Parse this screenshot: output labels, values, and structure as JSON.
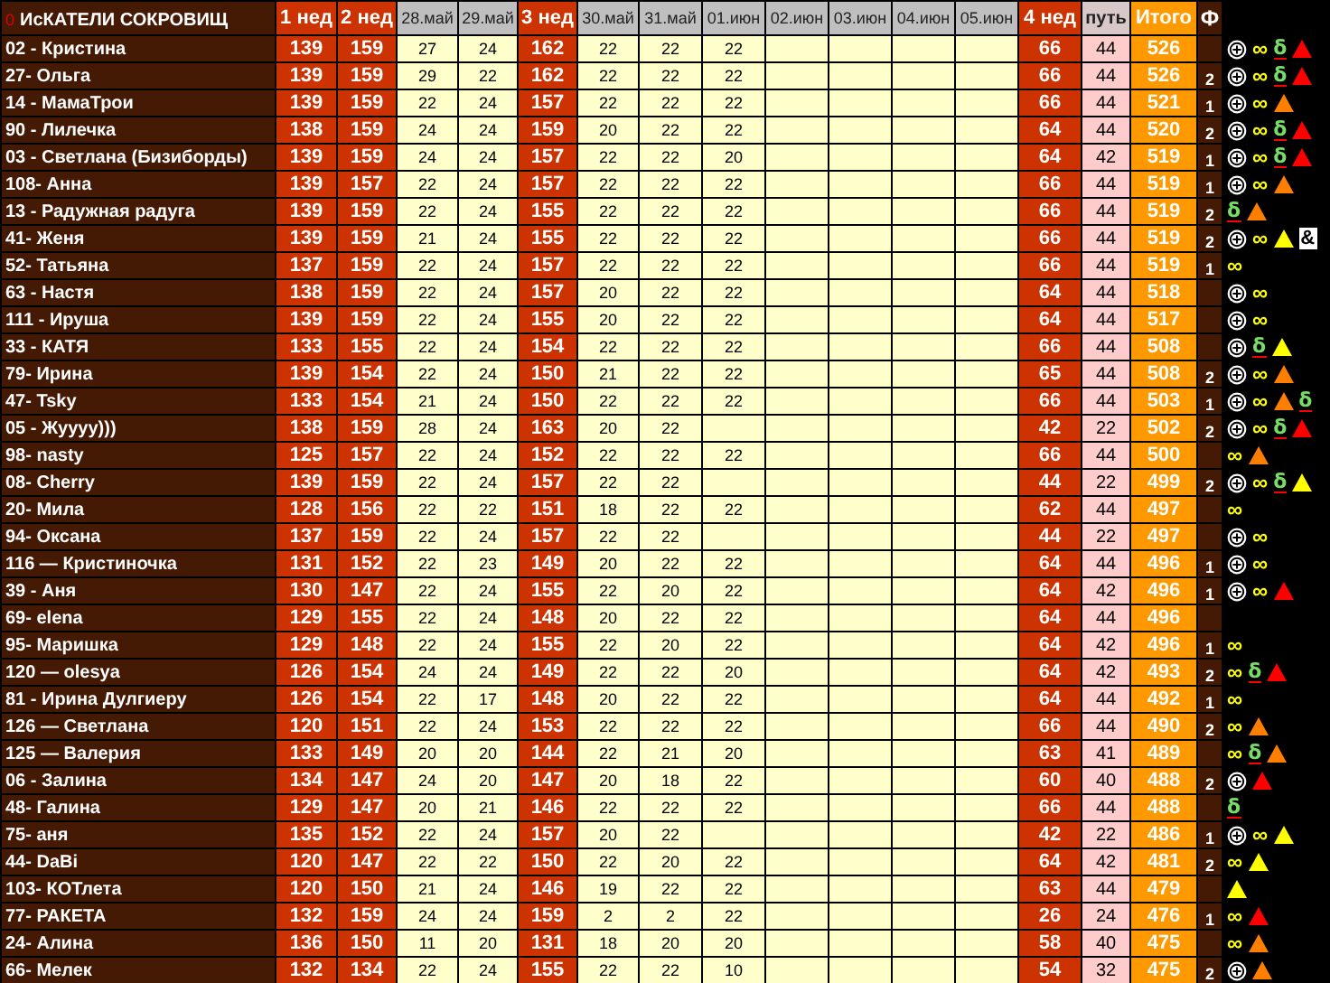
{
  "table": {
    "title_mark": "0",
    "title": "ИсКАТЕЛИ СОКРОВИЩ",
    "columns": [
      {
        "label": "1 нед",
        "kind": "week"
      },
      {
        "label": "2 нед",
        "kind": "week"
      },
      {
        "label": "28.май",
        "kind": "day"
      },
      {
        "label": "29.май",
        "kind": "day"
      },
      {
        "label": "3 нед",
        "kind": "week"
      },
      {
        "label": "30.май",
        "kind": "day"
      },
      {
        "label": "31.май",
        "kind": "day"
      },
      {
        "label": "01.июн",
        "kind": "day"
      },
      {
        "label": "02.июн",
        "kind": "day"
      },
      {
        "label": "03.июн",
        "kind": "day"
      },
      {
        "label": "04.июн",
        "kind": "day"
      },
      {
        "label": "05.июн",
        "kind": "day"
      },
      {
        "label": "4 нед",
        "kind": "week"
      },
      {
        "label": "путь",
        "kind": "path"
      },
      {
        "label": "Итого",
        "kind": "total"
      },
      {
        "label": "Ф",
        "kind": "phi"
      }
    ],
    "rows": [
      {
        "name": "02 - Кристина",
        "scores": [
          "139",
          "159",
          "27",
          "24",
          "162",
          "22",
          "22",
          "22"
        ],
        "totals": [
          "66",
          "44",
          "526"
        ],
        "marks": [
          {
            "kind": "circle"
          },
          {
            "kind": "symbol",
            "text": "∞"
          },
          {
            "kind": "delta",
            "text": "δ"
          },
          {
            "kind": "triangle",
            "color": "#ff0000"
          }
        ]
      },
      {
        "name": "27- Ольга",
        "scores": [
          "139",
          "159",
          "29",
          "22",
          "162",
          "22",
          "22",
          "22"
        ],
        "totals": [
          "66",
          "44",
          "526",
          "2"
        ],
        "marks": [
          {
            "kind": "circle"
          },
          {
            "kind": "symbol",
            "text": "∞"
          },
          {
            "kind": "delta",
            "text": "δ"
          },
          {
            "kind": "triangle",
            "color": "#ff0000"
          }
        ]
      },
      {
        "name": "14 - МамаТрои",
        "scores": [
          "139",
          "159",
          "22",
          "24",
          "157",
          "22",
          "22",
          "22"
        ],
        "totals": [
          "66",
          "44",
          "521",
          "1"
        ],
        "marks": [
          {
            "kind": "circle"
          },
          {
            "kind": "symbol",
            "text": "∞"
          },
          {
            "kind": "triangle",
            "color": "#ff8000"
          }
        ]
      },
      {
        "name": "90 - Лилечка",
        "scores": [
          "138",
          "159",
          "24",
          "24",
          "159",
          "20",
          "22",
          "22"
        ],
        "totals": [
          "64",
          "44",
          "520",
          "2"
        ],
        "marks": [
          {
            "kind": "circle"
          },
          {
            "kind": "symbol",
            "text": "∞"
          },
          {
            "kind": "delta",
            "text": "δ"
          },
          {
            "kind": "triangle",
            "color": "#ff0000"
          }
        ]
      },
      {
        "name": "03 - Светлана (Бизиборды)",
        "scores": [
          "139",
          "159",
          "24",
          "24",
          "157",
          "22",
          "22",
          "20"
        ],
        "totals": [
          "64",
          "42",
          "519",
          "1"
        ],
        "marks": [
          {
            "kind": "circle"
          },
          {
            "kind": "symbol",
            "text": "∞"
          },
          {
            "kind": "delta",
            "text": "δ"
          },
          {
            "kind": "triangle",
            "color": "#ff0000"
          }
        ]
      },
      {
        "name": "108- Анна",
        "scores": [
          "139",
          "157",
          "22",
          "24",
          "157",
          "22",
          "22",
          "22"
        ],
        "totals": [
          "66",
          "44",
          "519",
          "1"
        ],
        "marks": [
          {
            "kind": "circle"
          },
          {
            "kind": "symbol",
            "text": "∞"
          },
          {
            "kind": "triangle",
            "color": "#ff8000"
          }
        ]
      },
      {
        "name": "13 - Радужная радуга",
        "scores": [
          "139",
          "159",
          "22",
          "24",
          "155",
          "22",
          "22",
          "22"
        ],
        "totals": [
          "66",
          "44",
          "519",
          "2"
        ],
        "marks": [
          {
            "kind": "delta",
            "text": "δ"
          },
          {
            "kind": "triangle",
            "color": "#ff8000"
          }
        ]
      },
      {
        "name": "41- Женя",
        "scores": [
          "139",
          "159",
          "21",
          "24",
          "155",
          "22",
          "22",
          "22"
        ],
        "totals": [
          "66",
          "44",
          "519",
          "2"
        ],
        "marks": [
          {
            "kind": "circle"
          },
          {
            "kind": "symbol",
            "text": "∞"
          },
          {
            "kind": "triangle",
            "color": "#ffff00"
          },
          {
            "kind": "box",
            "text": "&"
          }
        ]
      },
      {
        "name": "52- Татьяна",
        "scores": [
          "137",
          "159",
          "22",
          "24",
          "157",
          "22",
          "22",
          "22"
        ],
        "totals": [
          "66",
          "44",
          "519",
          "1"
        ],
        "marks": [
          {
            "kind": "symbol",
            "text": "∞"
          }
        ]
      },
      {
        "name": "63 - Настя",
        "scores": [
          "138",
          "159",
          "22",
          "24",
          "157",
          "20",
          "22",
          "22"
        ],
        "totals": [
          "64",
          "44",
          "518"
        ],
        "marks": [
          {
            "kind": "circle"
          },
          {
            "kind": "symbol",
            "text": "∞"
          }
        ]
      },
      {
        "name": "111 - Ируша",
        "scores": [
          "139",
          "159",
          "22",
          "24",
          "155",
          "20",
          "22",
          "22"
        ],
        "totals": [
          "64",
          "44",
          "517"
        ],
        "marks": [
          {
            "kind": "circle"
          },
          {
            "kind": "symbol",
            "text": "∞"
          }
        ]
      },
      {
        "name": "33 - КАТЯ",
        "scores": [
          "133",
          "155",
          "22",
          "24",
          "154",
          "22",
          "22",
          "22"
        ],
        "totals": [
          "66",
          "44",
          "508"
        ],
        "marks": [
          {
            "kind": "circle"
          },
          {
            "kind": "delta",
            "text": "δ"
          },
          {
            "kind": "triangle",
            "color": "#ffff00"
          }
        ]
      },
      {
        "name": "79- Ирина",
        "scores": [
          "139",
          "154",
          "22",
          "24",
          "150",
          "21",
          "22",
          "22"
        ],
        "totals": [
          "65",
          "44",
          "508",
          "2"
        ],
        "marks": [
          {
            "kind": "circle"
          },
          {
            "kind": "symbol",
            "text": "∞"
          },
          {
            "kind": "triangle",
            "color": "#ff8000"
          }
        ]
      },
      {
        "name": "47- Tsky",
        "scores": [
          "133",
          "154",
          "21",
          "24",
          "150",
          "22",
          "22",
          "22"
        ],
        "totals": [
          "66",
          "44",
          "503",
          "1"
        ],
        "marks": [
          {
            "kind": "circle"
          },
          {
            "kind": "symbol",
            "text": "∞"
          },
          {
            "kind": "triangle",
            "color": "#ff8000"
          },
          {
            "kind": "delta",
            "text": "δ"
          }
        ]
      },
      {
        "name": "05 - Жуууу)))",
        "scores": [
          "138",
          "159",
          "28",
          "24",
          "163",
          "20",
          "22"
        ],
        "totals": [
          "42",
          "22",
          "502",
          "2"
        ],
        "marks": [
          {
            "kind": "circle"
          },
          {
            "kind": "symbol",
            "text": "∞"
          },
          {
            "kind": "delta",
            "text": "δ"
          },
          {
            "kind": "triangle",
            "color": "#ff0000"
          }
        ]
      },
      {
        "name": "98- nasty",
        "scores": [
          "125",
          "157",
          "22",
          "24",
          "152",
          "22",
          "22",
          "22"
        ],
        "totals": [
          "66",
          "44",
          "500"
        ],
        "marks": [
          {
            "kind": "symbol",
            "text": "∞"
          },
          {
            "kind": "triangle",
            "color": "#ff8000"
          }
        ]
      },
      {
        "name": "08- Cherry",
        "scores": [
          "139",
          "159",
          "22",
          "24",
          "157",
          "22",
          "22"
        ],
        "totals": [
          "44",
          "22",
          "499",
          "2"
        ],
        "marks": [
          {
            "kind": "circle"
          },
          {
            "kind": "symbol",
            "text": "∞"
          },
          {
            "kind": "delta",
            "text": "δ"
          },
          {
            "kind": "triangle",
            "color": "#ffff00"
          }
        ]
      },
      {
        "name": "20- Мила",
        "scores": [
          "128",
          "156",
          "22",
          "22",
          "151",
          "18",
          "22",
          "22"
        ],
        "totals": [
          "62",
          "44",
          "497"
        ],
        "marks": [
          {
            "kind": "symbol",
            "text": "∞"
          }
        ]
      },
      {
        "name": "94- Оксана",
        "scores": [
          "137",
          "159",
          "22",
          "24",
          "157",
          "22",
          "22"
        ],
        "totals": [
          "44",
          "22",
          "497"
        ],
        "marks": [
          {
            "kind": "circle"
          },
          {
            "kind": "symbol",
            "text": "∞"
          }
        ]
      },
      {
        "name": "116 — Кристиночка",
        "scores": [
          "131",
          "152",
          "22",
          "23",
          "149",
          "20",
          "22",
          "22"
        ],
        "totals": [
          "64",
          "44",
          "496",
          "1"
        ],
        "marks": [
          {
            "kind": "circle"
          },
          {
            "kind": "symbol",
            "text": "∞"
          }
        ]
      },
      {
        "name": "39 - Аня",
        "scores": [
          "130",
          "147",
          "22",
          "24",
          "155",
          "22",
          "20",
          "22"
        ],
        "totals": [
          "64",
          "42",
          "496",
          "1"
        ],
        "marks": [
          {
            "kind": "circle"
          },
          {
            "kind": "symbol",
            "text": "∞"
          },
          {
            "kind": "triangle",
            "color": "#ff0000"
          }
        ]
      },
      {
        "name": "69- elena",
        "scores": [
          "129",
          "155",
          "22",
          "24",
          "148",
          "20",
          "22",
          "22"
        ],
        "totals": [
          "64",
          "44",
          "496"
        ]
      },
      {
        "name": "95- Маришка",
        "scores": [
          "129",
          "148",
          "22",
          "24",
          "155",
          "22",
          "20",
          "22"
        ],
        "totals": [
          "64",
          "42",
          "496",
          "1"
        ],
        "marks": [
          {
            "kind": "symbol",
            "text": "∞"
          }
        ]
      },
      {
        "name": "120 — olesya",
        "scores": [
          "126",
          "154",
          "24",
          "24",
          "149",
          "22",
          "22",
          "20"
        ],
        "totals": [
          "64",
          "42",
          "493",
          "2"
        ],
        "marks": [
          {
            "kind": "symbol",
            "text": "∞"
          },
          {
            "kind": "delta",
            "text": "δ"
          },
          {
            "kind": "triangle",
            "color": "#ff0000"
          }
        ]
      },
      {
        "name": "81 - Ирина Дулгиеру",
        "scores": [
          "126",
          "154",
          "22",
          "17",
          "148",
          "20",
          "22",
          "22"
        ],
        "totals": [
          "64",
          "44",
          "492",
          "1"
        ],
        "marks": [
          {
            "kind": "symbol",
            "text": "∞"
          }
        ]
      },
      {
        "name": "126 — Светлана",
        "scores": [
          "120",
          "151",
          "22",
          "24",
          "153",
          "22",
          "22",
          "22"
        ],
        "totals": [
          "66",
          "44",
          "490",
          "2"
        ],
        "marks": [
          {
            "kind": "symbol",
            "text": "∞"
          },
          {
            "kind": "triangle",
            "color": "#ff8000"
          }
        ]
      },
      {
        "name": "125 — Валерия",
        "scores": [
          "133",
          "149",
          "20",
          "20",
          "144",
          "22",
          "21",
          "20"
        ],
        "totals": [
          "63",
          "41",
          "489"
        ],
        "marks": [
          {
            "kind": "symbol",
            "text": "∞"
          },
          {
            "kind": "delta",
            "text": "δ"
          },
          {
            "kind": "triangle",
            "color": "#ff8000"
          }
        ]
      },
      {
        "name": "06 - Залина",
        "scores": [
          "134",
          "147",
          "24",
          "20",
          "147",
          "20",
          "18",
          "22"
        ],
        "totals": [
          "60",
          "40",
          "488",
          "2"
        ],
        "marks": [
          {
            "kind": "circle"
          },
          {
            "kind": "triangle",
            "color": "#ff0000"
          }
        ]
      },
      {
        "name": "48- Галина",
        "scores": [
          "129",
          "147",
          "20",
          "21",
          "146",
          "22",
          "22",
          "22"
        ],
        "totals": [
          "66",
          "44",
          "488"
        ],
        "marks": [
          {
            "kind": "delta",
            "text": "δ"
          }
        ]
      },
      {
        "name": "75- аня",
        "scores": [
          "135",
          "152",
          "22",
          "24",
          "157",
          "20",
          "22"
        ],
        "totals": [
          "42",
          "22",
          "486",
          "1"
        ],
        "marks": [
          {
            "kind": "circle"
          },
          {
            "kind": "symbol",
            "text": "∞"
          },
          {
            "kind": "triangle",
            "color": "#ffff00"
          }
        ]
      },
      {
        "name": "44- DaBi",
        "scores": [
          "120",
          "147",
          "22",
          "22",
          "150",
          "22",
          "20",
          "22"
        ],
        "totals": [
          "64",
          "42",
          "481",
          "2"
        ],
        "marks": [
          {
            "kind": "symbol",
            "text": "∞"
          },
          {
            "kind": "triangle",
            "color": "#ffff00"
          }
        ]
      },
      {
        "name": "103- КОТлета",
        "scores": [
          "120",
          "150",
          "21",
          "24",
          "146",
          "19",
          "22",
          "22"
        ],
        "totals": [
          "63",
          "44",
          "479"
        ],
        "marks": [
          {
            "kind": "triangle",
            "color": "#ffff00"
          }
        ]
      },
      {
        "name": "77- РАКЕТА",
        "scores": [
          "132",
          "159",
          "24",
          "24",
          "159",
          "2",
          "2",
          "22"
        ],
        "totals": [
          "26",
          "24",
          "476",
          "1"
        ],
        "marks": [
          {
            "kind": "symbol",
            "text": "∞"
          },
          {
            "kind": "triangle",
            "color": "#ff0000"
          }
        ]
      },
      {
        "name": "24- Алина",
        "scores": [
          "136",
          "150",
          "11",
          "20",
          "131",
          "18",
          "20",
          "20"
        ],
        "totals": [
          "58",
          "40",
          "475"
        ],
        "marks": [
          {
            "kind": "symbol",
            "text": "∞"
          },
          {
            "kind": "triangle",
            "color": "#ff8000"
          }
        ]
      },
      {
        "name": "66- Мелек",
        "scores": [
          "132",
          "134",
          "22",
          "24",
          "155",
          "22",
          "22",
          "10"
        ],
        "totals": [
          "54",
          "32",
          "475",
          "2"
        ],
        "marks": [
          {
            "kind": "circle"
          },
          {
            "kind": "triangle",
            "color": "#ff8000"
          }
        ]
      }
    ]
  }
}
